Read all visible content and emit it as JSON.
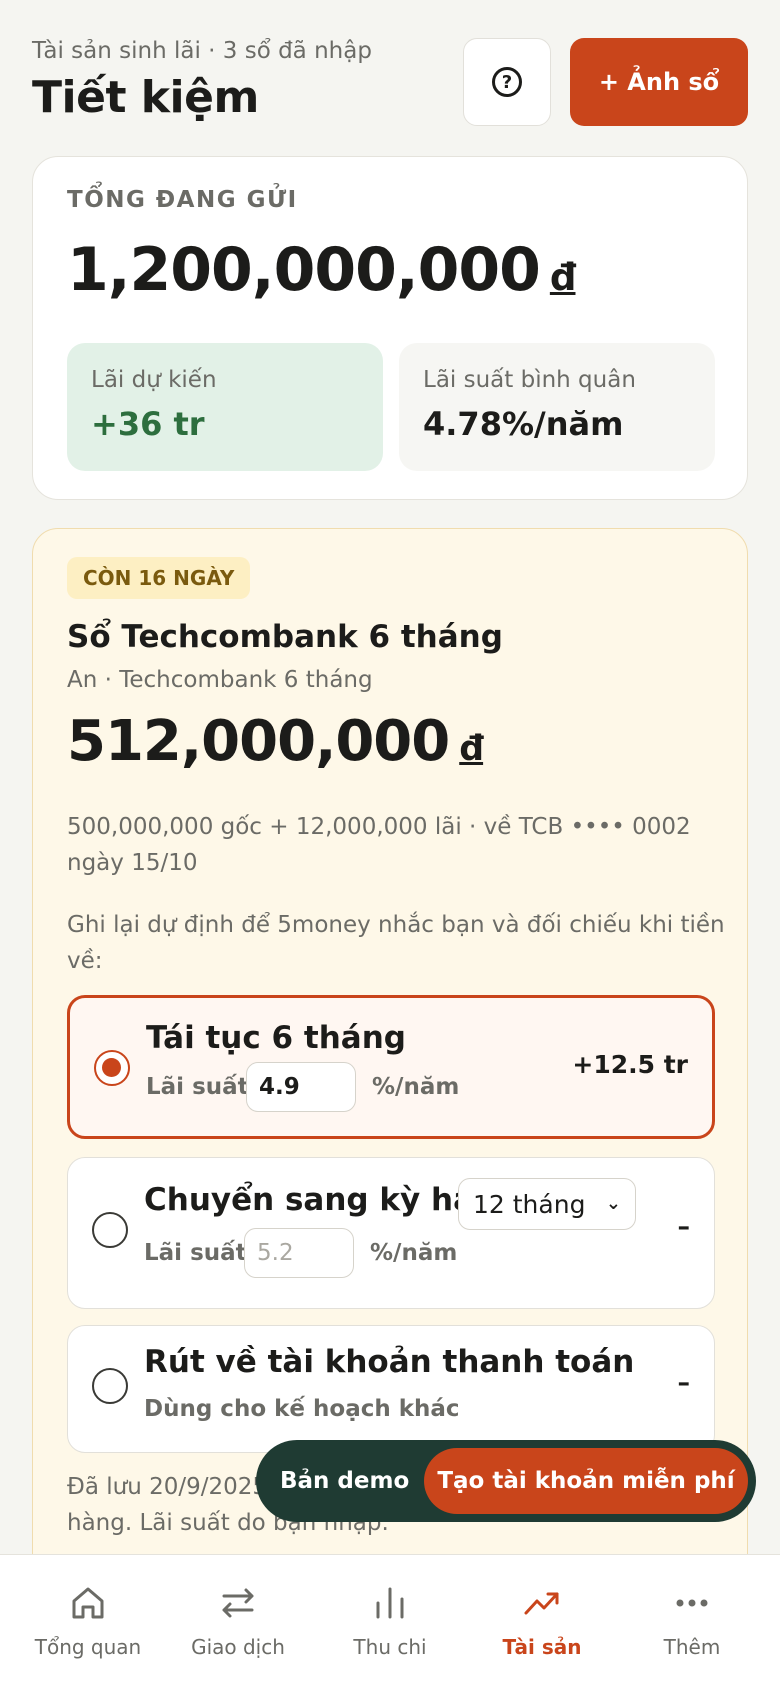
{
  "header": {
    "subtitle": "Tài sản sinh lãi · 3 sổ đã nhập",
    "title": "Tiết kiệm",
    "help_icon": "question-circle-icon",
    "add_photo_label": "+ Ảnh sổ"
  },
  "summary": {
    "label": "TỔNG ĐANG GỬI",
    "amount": "1,200,000,000",
    "currency": "đ",
    "expected_interest_label": "Lãi dự kiến",
    "expected_interest_value": "+36 tr",
    "avg_rate_label": "Lãi suất bình quân",
    "avg_rate_value": "4.78%/năm"
  },
  "book": {
    "badge": "CÒN 16 NGÀY",
    "title": "Sổ Techcombank 6 tháng",
    "subtitle": "An · Techcombank 6 tháng",
    "amount": "512,000,000",
    "currency": "đ",
    "note": "500,000,000 gốc + 12,000,000 lãi · về TCB •••• 0002 ngày 15/10",
    "intent_note": "Ghi lại dự định để 5money nhắc bạn và đối chiếu khi tiền về:",
    "options": [
      {
        "title": "Tái tục 6 tháng",
        "rate_label": "Lãi suất",
        "rate_value": "4.9",
        "rate_unit": "%/năm",
        "right": "+12.5 tr",
        "selected": true
      },
      {
        "title": "Chuyển sang kỳ hạn",
        "term_selected": "12 tháng",
        "rate_label": "Lãi suất",
        "rate_placeholder": "5.2",
        "rate_unit": "%/năm",
        "right": "–",
        "selected": false
      },
      {
        "title": "Rút về tài khoản thanh toán",
        "subtitle": "Dùng cho kế hoạch khác",
        "right": "–",
        "selected": false
      }
    ],
    "saved_note": "Đã lưu 20/9/2025 · 5money không tự thao tác với ngân hàng. Lãi suất do bạn nhập."
  },
  "demo": {
    "label": "Bản demo",
    "cta": "Tạo tài khoản miễn phí"
  },
  "nav": {
    "items": [
      {
        "label": "Tổng quan",
        "icon": "home-icon"
      },
      {
        "label": "Giao dịch",
        "icon": "swap-arrows-icon"
      },
      {
        "label": "Thu chi",
        "icon": "bar-chart-icon"
      },
      {
        "label": "Tài sản",
        "icon": "trending-up-icon",
        "active": true
      },
      {
        "label": "Thêm",
        "icon": "more-dots-icon"
      }
    ]
  },
  "colors": {
    "accent": "#c9451b",
    "positive": "#2d6e3e",
    "demo_bg": "#1f3b33",
    "warning_card_bg": "#fef8e8"
  }
}
